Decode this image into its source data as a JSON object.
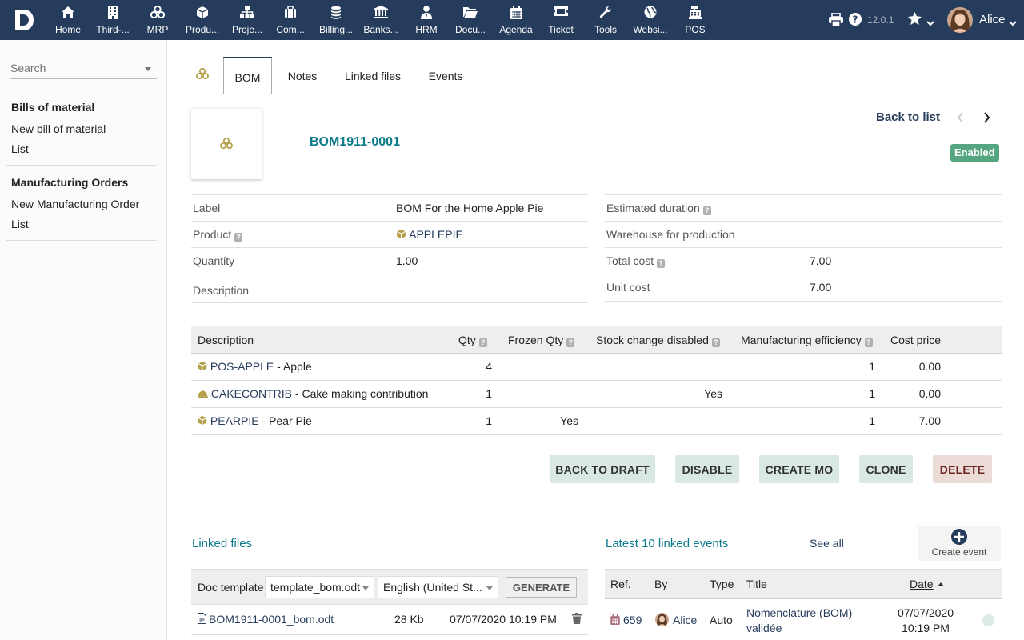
{
  "nav": {
    "items": [
      {
        "label": "Home",
        "icon": "home-icon"
      },
      {
        "label": "Third-...",
        "icon": "building-icon"
      },
      {
        "label": "MRP",
        "icon": "cubes-icon"
      },
      {
        "label": "Produ...",
        "icon": "cube-icon"
      },
      {
        "label": "Proje...",
        "icon": "sitemap-icon"
      },
      {
        "label": "Com...",
        "icon": "suitcase-icon"
      },
      {
        "label": "Billing...",
        "icon": "coins-icon"
      },
      {
        "label": "Banks...",
        "icon": "bank-icon"
      },
      {
        "label": "HRM",
        "icon": "user-tie-icon"
      },
      {
        "label": "Docu...",
        "icon": "folder-icon"
      },
      {
        "label": "Agenda",
        "icon": "calendar-icon"
      },
      {
        "label": "Ticket",
        "icon": "ticket-icon"
      },
      {
        "label": "Tools",
        "icon": "wrench-icon"
      },
      {
        "label": "Websi...",
        "icon": "globe-icon"
      },
      {
        "label": "POS",
        "icon": "cash-register-icon"
      }
    ],
    "version": "12.0.1",
    "user": "Alice"
  },
  "sidebar": {
    "search_placeholder": "Search",
    "section1_title": "Bills of material",
    "section1_new": "New bill of material",
    "section1_list": "List",
    "section2_title": "Manufacturing Orders",
    "section2_new": "New Manufacturing Order",
    "section2_list": "List"
  },
  "tabs": [
    "BOM",
    "Notes",
    "Linked files",
    "Events"
  ],
  "header": {
    "ref": "BOM1911-0001",
    "back_to_list": "Back to list",
    "status": "Enabled"
  },
  "fields_left": {
    "label_label": "Label",
    "label_value": "BOM For the Home Apple Pie",
    "product_label": "Product",
    "product_value": "APPLEPIE",
    "quantity_label": "Quantity",
    "quantity_value": "1.00",
    "description_label": "Description"
  },
  "fields_right": {
    "duration_label": "Estimated duration",
    "warehouse_label": "Warehouse for production",
    "total_cost_label": "Total cost",
    "total_cost_value": "7.00",
    "unit_cost_label": "Unit cost",
    "unit_cost_value": "7.00"
  },
  "lines": {
    "headers": [
      "Description",
      "Qty",
      "Frozen Qty",
      "Stock change disabled",
      "Manufacturing efficiency",
      "Cost price"
    ],
    "rows": [
      {
        "ref": "POS-APPLE",
        "desc": " - Apple",
        "qty": "4",
        "frozen": "",
        "stock_disabled": "",
        "efficiency": "1",
        "cost": "0.00",
        "icon": "cube-icon"
      },
      {
        "ref": "CAKECONTRIB",
        "desc": " - Cake making contribution",
        "qty": "1",
        "frozen": "",
        "stock_disabled": "Yes",
        "efficiency": "1",
        "cost": "0.00",
        "icon": "service-bell-icon"
      },
      {
        "ref": "PEARPIE",
        "desc": " - Pear Pie",
        "qty": "1",
        "frozen": "Yes",
        "stock_disabled": "",
        "efficiency": "1",
        "cost": "7.00",
        "icon": "cube-icon"
      }
    ]
  },
  "actions": {
    "back_to_draft": "BACK TO DRAFT",
    "disable": "DISABLE",
    "create_mo": "CREATE MO",
    "clone": "CLONE",
    "delete": "DELETE"
  },
  "linked_files": {
    "title": "Linked files",
    "doc_template_label": "Doc template",
    "template_value": "template_bom.odt",
    "language_value": "English (United St...",
    "generate": "GENERATE",
    "file_name": "BOM1911-0001_bom.odt",
    "file_size": "28 Kb",
    "file_date": "07/07/2020 10:19 PM"
  },
  "events": {
    "title": "Latest 10 linked events",
    "see_all": "See all",
    "create_event": "Create event",
    "headers": [
      "Ref.",
      "By",
      "Type",
      "Title",
      "Date"
    ],
    "row": {
      "ref": "659",
      "by": "Alice",
      "type": "Auto",
      "title_line1": "Nomenclature (BOM)",
      "title_line2": "validée",
      "date_line1": "07/07/2020",
      "date_line2": "10:19 PM"
    }
  },
  "colors": {
    "topbar": "#263c5c",
    "accent_teal": "#0a7a8a",
    "enabled_badge": "#55a580",
    "button_bg": "#d9e8e2",
    "delete_bg": "#ecdcd8",
    "product_icon": "#b5a04a"
  }
}
